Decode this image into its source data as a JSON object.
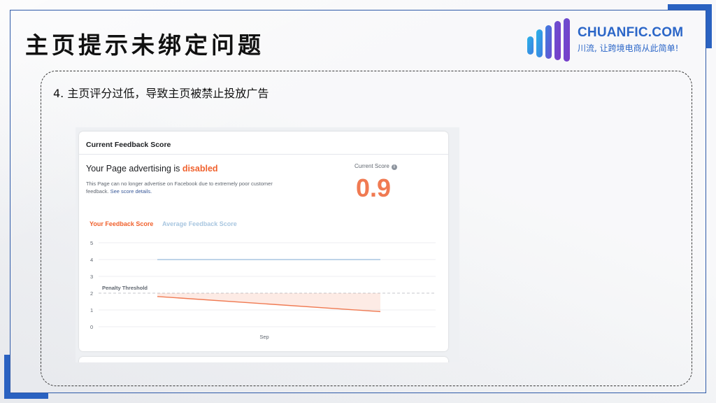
{
  "slide": {
    "title": "主页提示未绑定问题",
    "point_text": "4. 主页评分过低，导致主页被禁止投放广告"
  },
  "logo": {
    "title": "CHUANFIC.COM",
    "subtitle": "川流, 让跨境电商从此简单!",
    "colors": [
      "#2bb3e8",
      "#3d7ee0",
      "#6a4fd0",
      "#7a3bc8"
    ]
  },
  "panel": {
    "title": "Current Feedback Score",
    "status_prefix": "Your Page advertising is ",
    "status_value": "disabled",
    "description": "This Page can no longer advertise on Facebook due to extremely poor customer feedback. ",
    "details_link": "See score details.",
    "score_label": "Current Score",
    "score_icon": "info-icon",
    "score_value": "0.9"
  },
  "colors": {
    "accent_blue": "#2a62c1",
    "disabled": "#f0612d",
    "score": "#f07a52",
    "average_line": "#a8c6e0"
  },
  "chart_data": {
    "type": "line",
    "legend": [
      "Your Feedback Score",
      "Average Feedback Score"
    ],
    "y_ticks": [
      "5",
      "4",
      "3",
      "2",
      "1",
      "0"
    ],
    "ylim": [
      0,
      5
    ],
    "x_label": "Sep",
    "threshold": {
      "label": "Penalty Threshold",
      "value": 2
    },
    "series": [
      {
        "name": "Your Feedback Score",
        "start": 1.8,
        "end": 0.9,
        "color": "#f07a52"
      },
      {
        "name": "Average Feedback Score",
        "start": 4.0,
        "end": 4.0,
        "color": "#a8c6e0"
      }
    ]
  }
}
